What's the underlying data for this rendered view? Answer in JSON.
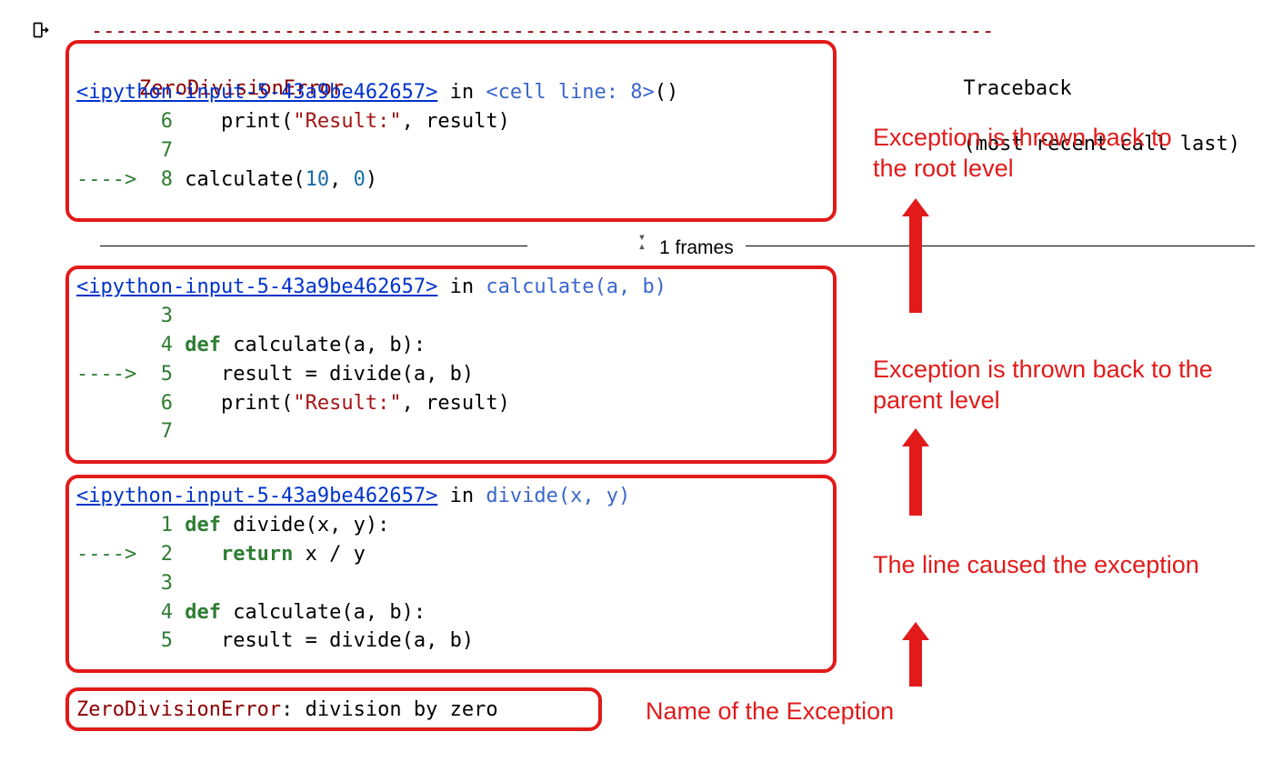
{
  "dashes": "---------------------------------------------------------------------------",
  "header": {
    "error": "ZeroDivisionError",
    "traceback_label": "Traceback",
    "recent_call": "(most recent call last)"
  },
  "frames_label": "1 frames",
  "box1": {
    "link": "<ipython-input-5-43a9be462657>",
    "in": " in ",
    "loc": "<cell line: 8>",
    "tail": "()",
    "lines": {
      "l6_no": "6",
      "l6_code_a": "    print(",
      "l6_str": "\"Result:\"",
      "l6_code_b": ", result)",
      "l7_no": "7",
      "arrow": "----> ",
      "l8_no": "8",
      "l8_code_a": " calculate(",
      "l8_n1": "10",
      "l8_sep": ", ",
      "l8_n2": "0",
      "l8_code_b": ")"
    }
  },
  "box2": {
    "link": "<ipython-input-5-43a9be462657>",
    "in": " in ",
    "fn": "calculate",
    "sig": "(a, b)",
    "lines": {
      "l3_no": "3",
      "l4_no": "4",
      "l4_def": " def",
      "l4_rest": " calculate(a, b):",
      "arrow": "----> ",
      "l5_no": "5",
      "l5_code": "    result = divide(a, b)",
      "l6_no": "6",
      "l6_code_a": "    print(",
      "l6_str": "\"Result:\"",
      "l6_code_b": ", result)",
      "l7_no": "7"
    }
  },
  "box3": {
    "link": "<ipython-input-5-43a9be462657>",
    "in": " in ",
    "fn": "divide",
    "sig": "(x, y)",
    "lines": {
      "l1_no": "1",
      "l1_def": " def",
      "l1_rest": " divide(x, y):",
      "arrow": "----> ",
      "l2_no": "2",
      "l2_ret": "    return",
      "l2_rest": " x / y",
      "l3_no": "3",
      "l4_no": "4",
      "l4_def": " def",
      "l4_rest": " calculate(a, b):",
      "l5_no": "5",
      "l5_code": "    result = divide(a, b)"
    }
  },
  "box4": {
    "error": "ZeroDivisionError",
    "sep": ": ",
    "msg": "division by zero"
  },
  "annotations": {
    "a1": "Exception is thrown back to the root level",
    "a2": "Exception is thrown back to the parent level",
    "a3": "The line caused the exception",
    "a4": "Name of the Exception"
  }
}
